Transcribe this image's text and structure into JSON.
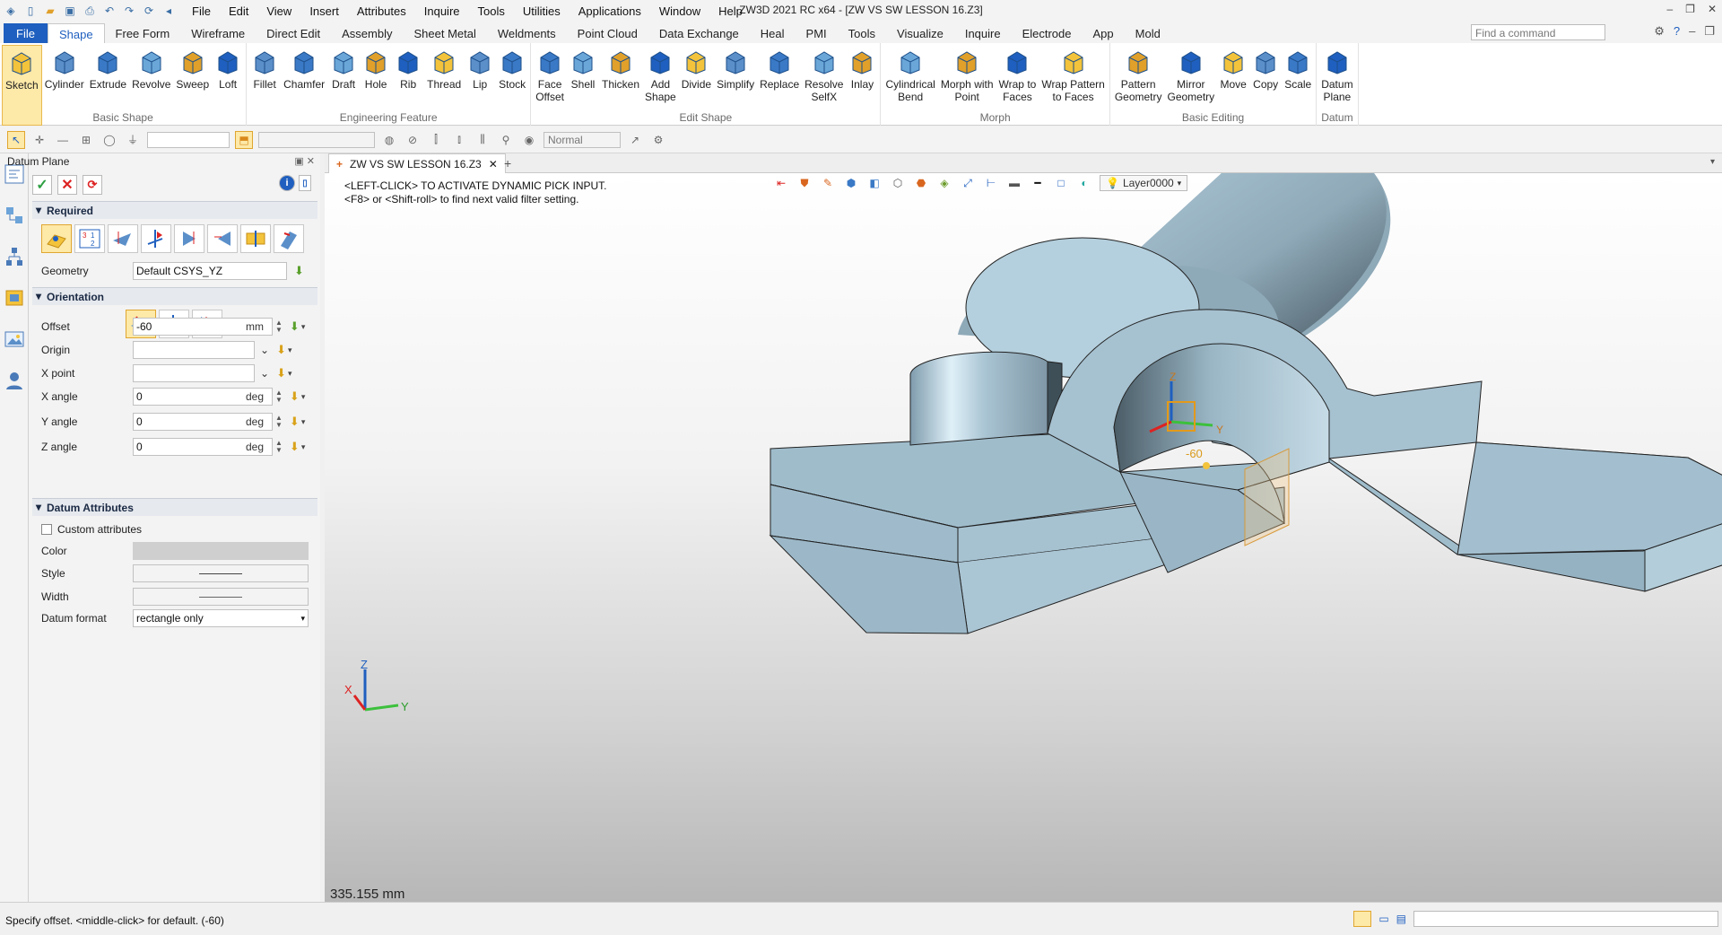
{
  "titlebar": {
    "menus": [
      "File",
      "Edit",
      "View",
      "Insert",
      "Attributes",
      "Inquire",
      "Tools",
      "Utilities",
      "Applications",
      "Window",
      "Help"
    ],
    "app_title": "ZW3D 2021 RC x64 - [ZW VS SW LESSON 16.Z3]"
  },
  "ribbon_tabs": [
    "Shape",
    "Free Form",
    "Wireframe",
    "Direct Edit",
    "Assembly",
    "Sheet Metal",
    "Weldments",
    "Point Cloud",
    "Data Exchange",
    "Heal",
    "PMI",
    "Tools",
    "Visualize",
    "Inquire",
    "Electrode",
    "App",
    "Mold"
  ],
  "file_tab": "File",
  "command_search": {
    "placeholder": "Find a command"
  },
  "ribbon_groups": [
    {
      "label": "Basic Shape",
      "tools": [
        "Sketch",
        "Cylinder",
        "Extrude",
        "Revolve",
        "Sweep",
        "Loft"
      ]
    },
    {
      "label": "Engineering Feature",
      "tools": [
        "Fillet",
        "Chamfer",
        "Draft",
        "Hole",
        "Rib",
        "Thread",
        "Lip",
        "Stock"
      ]
    },
    {
      "label": "Edit Shape",
      "tools": [
        "Face\nOffset",
        "Shell",
        "Thicken",
        "Add\nShape",
        "Divide",
        "Simplify",
        "Replace",
        "Resolve\nSelfX",
        "Inlay"
      ]
    },
    {
      "label": "Morph",
      "tools": [
        "Cylindrical\nBend",
        "Morph with\nPoint",
        "Wrap to\nFaces",
        "Wrap Pattern\nto Faces"
      ]
    },
    {
      "label": "Basic Editing",
      "tools": [
        "Pattern\nGeometry",
        "Mirror\nGeometry",
        "Move",
        "Copy",
        "Scale"
      ]
    },
    {
      "label": "Datum",
      "tools": [
        "Datum\nPlane"
      ]
    }
  ],
  "toolbar2": {
    "render_mode": "Normal"
  },
  "panel": {
    "title": "Datum Plane",
    "required_label": "Required",
    "geometry_label": "Geometry",
    "geometry_value": "Default CSYS_YZ",
    "orientation_label": "Orientation",
    "fields": [
      {
        "label": "Offset",
        "value": "-60",
        "unit": "mm"
      },
      {
        "label": "Origin",
        "value": "",
        "unit": ""
      },
      {
        "label": "X point",
        "value": "",
        "unit": ""
      },
      {
        "label": "X angle",
        "value": "0",
        "unit": "deg"
      },
      {
        "label": "Y angle",
        "value": "0",
        "unit": "deg"
      },
      {
        "label": "Z angle",
        "value": "0",
        "unit": "deg"
      }
    ],
    "datum_attr_label": "Datum Attributes",
    "custom_attr_label": "Custom attributes",
    "color_label": "Color",
    "style_label": "Style",
    "width_label": "Width",
    "datum_format_label": "Datum format",
    "datum_format_value": "rectangle only"
  },
  "document": {
    "tab_title": "ZW VS SW LESSON 16.Z3",
    "prompt_line1": "<LEFT-CLICK> TO ACTIVATE DYNAMIC PICK INPUT.",
    "prompt_line2": "<F8> or <Shift-roll> to find next valid filter setting.",
    "layer": "Layer0000",
    "offset_tag": "-60",
    "axis_x": "X",
    "axis_y": "Y",
    "axis_z": "Z",
    "measure": "335.155 mm"
  },
  "status": {
    "text": "Specify offset.  <middle-click> for default. (-60)"
  },
  "colors": {
    "accent": "#1f5fbf",
    "part": "#a9c6d6",
    "highlight": "#fde9a8"
  }
}
